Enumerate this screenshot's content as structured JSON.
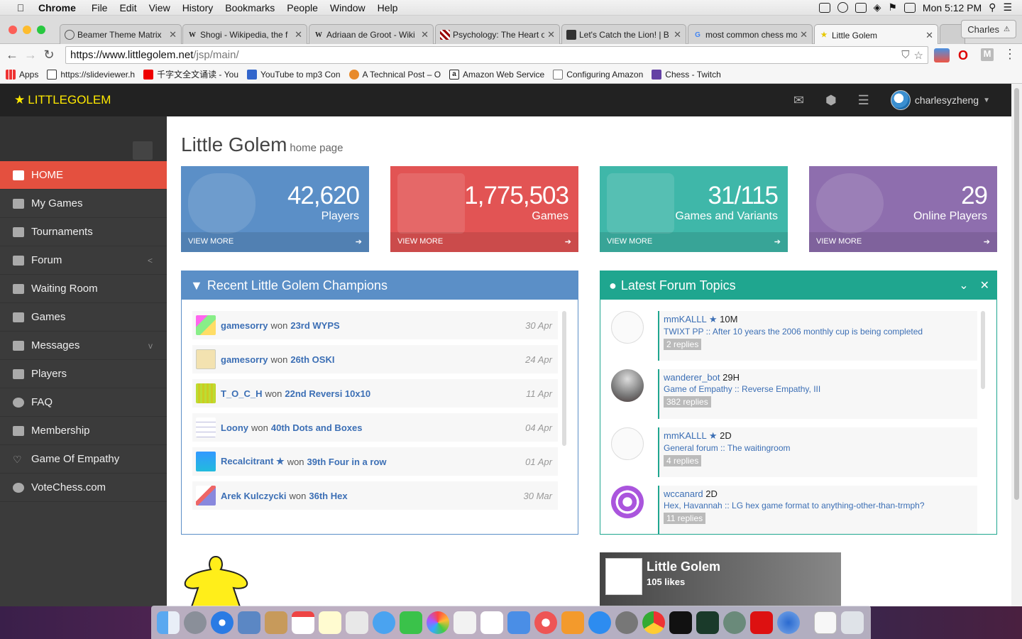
{
  "menubar": {
    "app": "Chrome",
    "items": [
      "File",
      "Edit",
      "View",
      "History",
      "Bookmarks",
      "People",
      "Window",
      "Help"
    ],
    "clock": "Mon 5:12 PM"
  },
  "tabs": [
    {
      "title": "Beamer Theme Matrix"
    },
    {
      "title": "Shogi - Wikipedia, the f"
    },
    {
      "title": "Adriaan de Groot - Wiki"
    },
    {
      "title": "Psychology: The Heart o"
    },
    {
      "title": "Let's Catch the Lion! | B"
    },
    {
      "title": "most common chess mo"
    },
    {
      "title": "Little Golem"
    }
  ],
  "profile": "Charles",
  "url": {
    "host": "https://www.littlegolem.net",
    "path": "/jsp/main/"
  },
  "bookmarks": [
    {
      "label": "Apps"
    },
    {
      "label": "https://slideviewer.h"
    },
    {
      "label": "千字文全文诵读 - You"
    },
    {
      "label": "YouTube to mp3 Con"
    },
    {
      "label": "A Technical Post – O"
    },
    {
      "label": "Amazon Web Service"
    },
    {
      "label": "Configuring Amazon"
    },
    {
      "label": "Chess - Twitch"
    }
  ],
  "brand": "LITTLEGOLEM",
  "username": "charlesyzheng",
  "sidebar": {
    "items": [
      {
        "label": "HOME"
      },
      {
        "label": "My Games"
      },
      {
        "label": "Tournaments"
      },
      {
        "label": "Forum"
      },
      {
        "label": "Waiting Room"
      },
      {
        "label": "Games"
      },
      {
        "label": "Messages"
      },
      {
        "label": "Players"
      },
      {
        "label": "FAQ"
      },
      {
        "label": "Membership"
      },
      {
        "label": "Game Of Empathy"
      },
      {
        "label": "VoteChess.com"
      }
    ]
  },
  "page": {
    "title": "Little Golem",
    "subtitle": "home page"
  },
  "stats": [
    {
      "value": "42,620",
      "label": "Players",
      "more": "VIEW MORE",
      "color": "#5b8fc7"
    },
    {
      "value": "1,775,503",
      "label": "Games",
      "more": "VIEW MORE",
      "color": "#e25454"
    },
    {
      "value": "31/115",
      "label": "Games and Variants",
      "more": "VIEW MORE",
      "color": "#3fb7a9"
    },
    {
      "value": "29",
      "label": "Online Players",
      "more": "VIEW MORE",
      "color": "#8e6eae"
    }
  ],
  "champions": {
    "title": "Recent Little Golem Champions",
    "won": "won",
    "rows": [
      {
        "who": "gamesorry",
        "what": "23rd WYPS",
        "date": "30 Apr"
      },
      {
        "who": "gamesorry",
        "what": "26th OSKI",
        "date": "24 Apr"
      },
      {
        "who": "T_O_C_H",
        "what": "22nd Reversi 10x10",
        "date": "11 Apr"
      },
      {
        "who": "Loony",
        "what": "40th Dots and Boxes",
        "date": "04 Apr"
      },
      {
        "who": "Recalcitrant ★",
        "what": "39th Four in a row",
        "date": "01 Apr"
      },
      {
        "who": "Arek Kulczycki",
        "what": "36th Hex",
        "date": "30 Mar"
      }
    ]
  },
  "forum": {
    "title": "Latest Forum Topics",
    "items": [
      {
        "name": "mmKALLL ★",
        "age": "10M",
        "topic": "TWIXT PP :: After 10 years the 2006 monthly cup is being completed",
        "replies": "2 replies"
      },
      {
        "name": "wanderer_bot",
        "age": "29H",
        "topic": "Game of Empathy :: Reverse Empathy, III",
        "replies": "382 replies"
      },
      {
        "name": "mmKALLL ★",
        "age": "2D",
        "topic": "General forum :: The waitingroom",
        "replies": "4 replies"
      },
      {
        "name": "wccanard",
        "age": "2D",
        "topic": "Hex, Havannah :: LG hex game format to anything-other-than-trmph?",
        "replies": "11 replies"
      }
    ]
  },
  "facebook": {
    "title": "Little Golem",
    "likes": "105 likes"
  }
}
